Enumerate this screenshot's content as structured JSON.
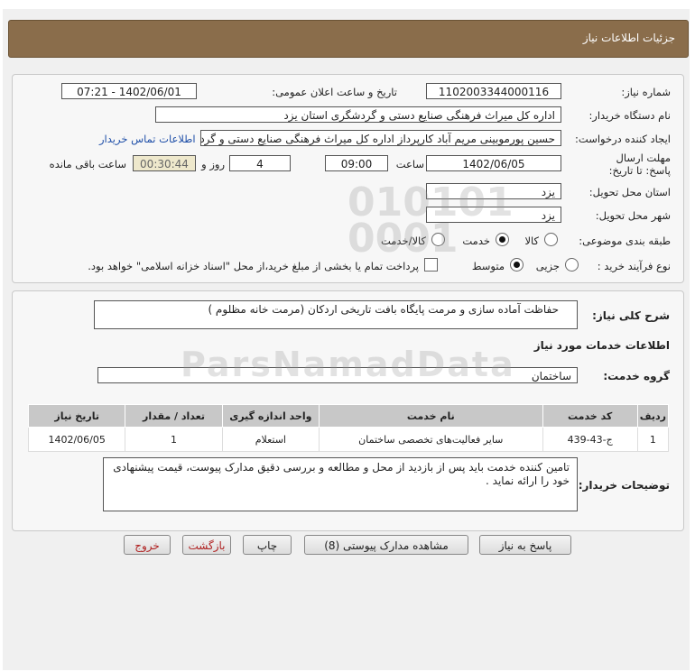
{
  "header": {
    "title": "جزئیات اطلاعات نیاز"
  },
  "form": {
    "need_number_label": "شماره نیاز:",
    "need_number": "1102003344000116",
    "announce_label": "تاریخ و ساعت اعلان عمومی:",
    "announce_value": "1402/06/01 - 07:21",
    "buyer_org_label": "نام دستگاه خریدار:",
    "buyer_org": "اداره کل میراث فرهنگی  صنایع دستی و گردشگری استان یزد",
    "creator_label": "ایجاد کننده درخواست:",
    "creator": "حسین پورموبینی مریم آباد کارپرداز اداره کل میراث فرهنگی  صنایع دستی و گردشگری استان یزد",
    "contact_link": "اطلاعات تماس خریدار",
    "deadline_label": "مهلت ارسال پاسخ: تا تاریخ:",
    "deadline_date": "1402/06/05",
    "time_label": "ساعت",
    "deadline_time": "09:00",
    "days_value": "4",
    "days_label": "روز و",
    "remaining_value": "00:30:44",
    "remaining_label": "ساعت باقی مانده",
    "province_label": "استان محل تحویل:",
    "province": "یزد",
    "city_label": "شهر محل تحویل:",
    "city": "یزد",
    "category_label": "طبقه بندی موضوعی:",
    "category_options": [
      "کالا",
      "خدمت",
      "کالا/خدمت"
    ],
    "category_selected": "خدمت",
    "process_label": "نوع فرآیند خرید :",
    "process_options": [
      "جزیی",
      "متوسط"
    ],
    "process_selected": "متوسط",
    "payment_note": "پرداخت تمام یا بخشی از مبلغ خرید،از محل \"اسناد خزانه اسلامی\" خواهد بود."
  },
  "description": {
    "label": "شرح کلی نیاز:",
    "value": "حفاظت آماده سازی و مرمت پایگاه بافت تاریخی اردکان (مرمت خانه مظلوم )"
  },
  "services": {
    "section_title": "اطلاعات خدمات مورد نیاز",
    "group_label": "گروه خدمت:",
    "group_value": "ساختمان",
    "columns": [
      "ردیف",
      "کد خدمت",
      "نام خدمت",
      "واحد اندازه گیری",
      "تعداد / مقدار",
      "تاریخ نیاز"
    ],
    "rows": [
      [
        "1",
        "ج-43-439",
        "سایر فعالیت‌های تخصصی ساختمان",
        "استعلام",
        "1",
        "1402/06/05"
      ]
    ]
  },
  "buyer_notes": {
    "label": "توضیحات خریدار:",
    "value": "تامین کننده خدمت باید پس از بازدید از محل و مطالعه و بررسی دقیق مدارک پیوست، قیمت پیشنهادی خود را ارائه نماید ."
  },
  "buttons": {
    "reply": "پاسخ به نیاز",
    "attachments": "مشاهده مدارک پیوستی (8)",
    "print": "چاپ",
    "back": "بازگشت",
    "exit": "خروج"
  },
  "colors": {
    "header": "#8a6d4b",
    "link": "#1f4fa8",
    "exit_text": "#b02020"
  }
}
